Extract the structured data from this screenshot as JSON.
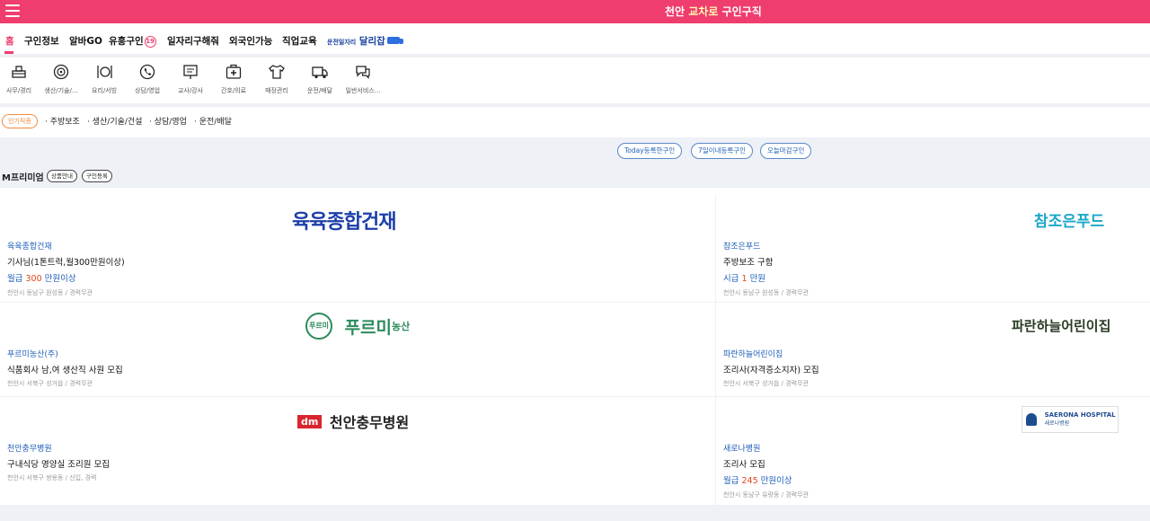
{
  "header": {
    "title_prefix": "천안 ",
    "title_accent": "교차로",
    "title_suffix": " 구인구직"
  },
  "nav": {
    "items": [
      "홈",
      "구인정보",
      "알바GO",
      "유흥구인",
      "일자리구해줘",
      "외국인가능",
      "직업교육"
    ],
    "adult_badge": "19",
    "drive_small": "운전일자리",
    "drive_big": "달리잡"
  },
  "categories": [
    "사무/경리",
    "생산/기술/...",
    "요리/서빙",
    "상담/영업",
    "교사/강사",
    "간호/의료",
    "매장관리",
    "운전/배달",
    "일반서비스..."
  ],
  "popular": {
    "badge": "인기직종",
    "items": [
      "· 주방보조",
      "· 생산/기술/건설",
      "· 상담/영업",
      "· 운전/배달"
    ]
  },
  "filters": [
    "Today등록한구인",
    "7일이내등록구인",
    "오늘마감구인"
  ],
  "premium": {
    "title": "M프리미엄",
    "btn_info": "상품안내",
    "btn_register": "구인등록"
  },
  "listings": [
    {
      "logo": "육육종합건재",
      "company": "육육종합건재",
      "title": "기사님(1톤트럭,월300만원이상)",
      "salary_label": "월급 ",
      "salary_num": "300",
      "salary_unit": " 만원이상",
      "location": "천안시 동남구 원성동 / 경력무관"
    },
    {
      "logo": "참조은푸드",
      "company": "참조은푸드",
      "title": "주방보조 구함",
      "salary_label": "시급 ",
      "salary_num": "1",
      "salary_unit": " 만원",
      "location": "천안시 동남구 원성동 / 경력무관"
    },
    {
      "logo_mark": "푸르미",
      "logo": "푸르미",
      "logo_sub": "농산",
      "company": "푸르미농산(주)",
      "title": "식품회사 남,여 생산직 사원 모집",
      "location": "천안시 서북구 성거읍 / 경력무관"
    },
    {
      "logo": "파란하늘어린이집",
      "company": "파란하늘어린이집",
      "title": "조리사(자격증소지자) 모집",
      "location": "천안시 서북구 성거읍 / 경력무관"
    },
    {
      "logo_mark": "dm",
      "logo": "천안충무병원",
      "company": "천안충무병원",
      "title": "구내식당 영양실 조리원 모집",
      "location": "천안시 서북구 쌍용동 / 신입, 경력"
    },
    {
      "logo": "SAERONA HOSPITAL",
      "logo_sub": "새로나병원",
      "company": "새로나병원",
      "title": "조리사 모집",
      "salary_label": "월급 ",
      "salary_num": "245",
      "salary_unit": " 만원이상",
      "location": "천안시 동남구 유량동 / 경력무관"
    }
  ],
  "colors": {
    "brand": "#ef3d6e",
    "link_blue": "#1f5fb8",
    "salary_red": "#e0471c",
    "band": "#eef1f6"
  },
  "icons": [
    "menu-icon",
    "desk-icon",
    "gear-icon",
    "utensils-icon",
    "phone-icon",
    "board-icon",
    "medical-kit-icon",
    "shirt-icon",
    "truck-icon",
    "chat-icon"
  ]
}
